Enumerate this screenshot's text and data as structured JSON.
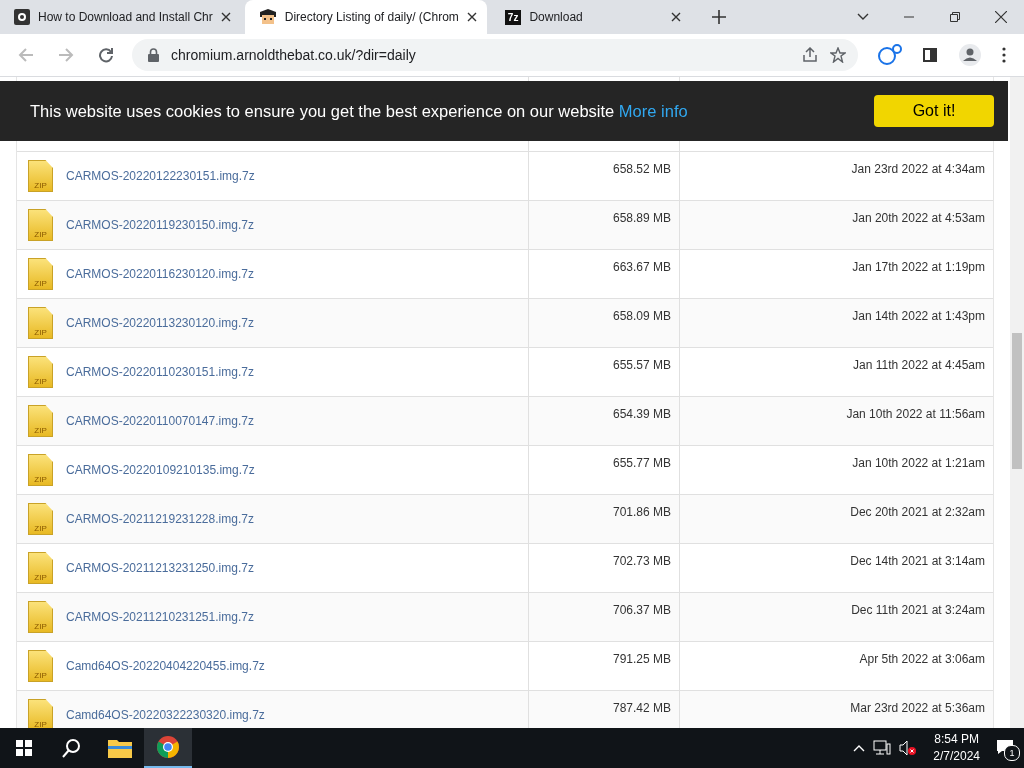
{
  "tabs": [
    {
      "title": "How to Download and Install Chr",
      "selected": false,
      "kind": "camera"
    },
    {
      "title": "Directory Listing of daily/ (Chrom",
      "selected": true,
      "kind": "face"
    },
    {
      "title": "Download",
      "selected": false,
      "kind": "sevenzip"
    }
  ],
  "sevenzip_favicon_text": "7z",
  "address_bar": {
    "url": "chromium.arnoldthebat.co.uk/?dir=daily"
  },
  "cookie_banner": {
    "message": "This website uses cookies to ensure you get the best experience on our website",
    "link": "More info",
    "button": "Got it!"
  },
  "files": [
    {
      "name": "CARMOS-20220122230151.img.7z",
      "size": "658.52 MB",
      "date": "Jan 23rd 2022 at 4:34am",
      "badge": "ZIP"
    },
    {
      "name": "CARMOS-20220119230150.img.7z",
      "size": "658.89 MB",
      "date": "Jan 20th 2022 at 4:53am",
      "badge": "ZIP"
    },
    {
      "name": "CARMOS-20220116230120.img.7z",
      "size": "663.67 MB",
      "date": "Jan 17th 2022 at 1:19pm",
      "badge": "ZIP"
    },
    {
      "name": "CARMOS-20220113230120.img.7z",
      "size": "658.09 MB",
      "date": "Jan 14th 2022 at 1:43pm",
      "badge": "ZIP"
    },
    {
      "name": "CARMOS-20220110230151.img.7z",
      "size": "655.57 MB",
      "date": "Jan 11th 2022 at 4:45am",
      "badge": "ZIP"
    },
    {
      "name": "CARMOS-20220110070147.img.7z",
      "size": "654.39 MB",
      "date": "Jan 10th 2022 at 11:56am",
      "badge": "ZIP"
    },
    {
      "name": "CARMOS-20220109210135.img.7z",
      "size": "655.77 MB",
      "date": "Jan 10th 2022 at 1:21am",
      "badge": "ZIP"
    },
    {
      "name": "CARMOS-20211219231228.img.7z",
      "size": "701.86 MB",
      "date": "Dec 20th 2021 at 2:32am",
      "badge": "ZIP"
    },
    {
      "name": "CARMOS-20211213231250.img.7z",
      "size": "702.73 MB",
      "date": "Dec 14th 2021 at 3:14am",
      "badge": "ZIP"
    },
    {
      "name": "CARMOS-20211210231251.img.7z",
      "size": "706.37 MB",
      "date": "Dec 11th 2021 at 3:24am",
      "badge": "ZIP"
    },
    {
      "name": "Camd64OS-20220404220455.img.7z",
      "size": "791.25 MB",
      "date": "Apr 5th 2022 at 3:06am",
      "badge": "ZIP"
    },
    {
      "name": "Camd64OS-20220322230320.img.7z",
      "size": "787.42 MB",
      "date": "Mar 23rd 2022 at 5:36am",
      "badge": "ZIP"
    }
  ],
  "taskbar": {
    "time": "8:54 PM",
    "date": "2/7/2024",
    "notification_count": "1",
    "apps": [
      {
        "kind": "explorer",
        "selected": false
      },
      {
        "kind": "chrome",
        "selected": true
      }
    ]
  }
}
